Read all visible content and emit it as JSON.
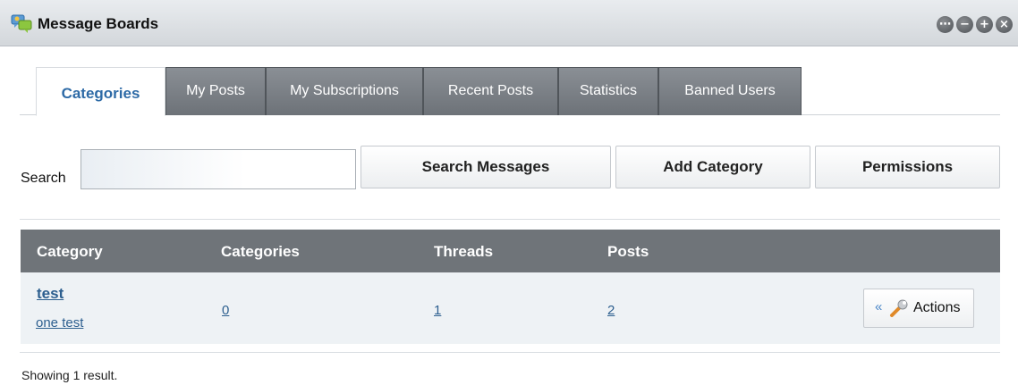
{
  "portlet": {
    "title": "Message Boards",
    "icon": "message-boards-icon",
    "controls": [
      {
        "name": "options-icon",
        "glyph": "⋯"
      },
      {
        "name": "minimize-icon",
        "glyph": "−"
      },
      {
        "name": "maximize-icon",
        "glyph": "+"
      },
      {
        "name": "close-icon",
        "glyph": "×"
      }
    ]
  },
  "tabs": [
    {
      "label": "Categories",
      "active": true
    },
    {
      "label": "My Posts",
      "active": false
    },
    {
      "label": "My Subscriptions",
      "active": false
    },
    {
      "label": "Recent Posts",
      "active": false
    },
    {
      "label": "Statistics",
      "active": false
    },
    {
      "label": "Banned Users",
      "active": false
    }
  ],
  "search": {
    "label": "Search",
    "value": "",
    "placeholder": ""
  },
  "buttons": {
    "search_messages": "Search Messages",
    "add_category": "Add Category",
    "permissions": "Permissions"
  },
  "table": {
    "columns": [
      "Category",
      "Categories",
      "Threads",
      "Posts"
    ],
    "rows": [
      {
        "name": "test",
        "description": "one test",
        "categories": "0",
        "threads": "1",
        "posts": "2",
        "actions_label": "Actions"
      }
    ]
  },
  "footer": {
    "result_text": "Showing 1 result."
  },
  "colors": {
    "link": "#2d5f8f",
    "active_tab_text": "#2d6aa6",
    "table_header_bg": "#6f7479",
    "row_bg": "#eef2f5"
  }
}
